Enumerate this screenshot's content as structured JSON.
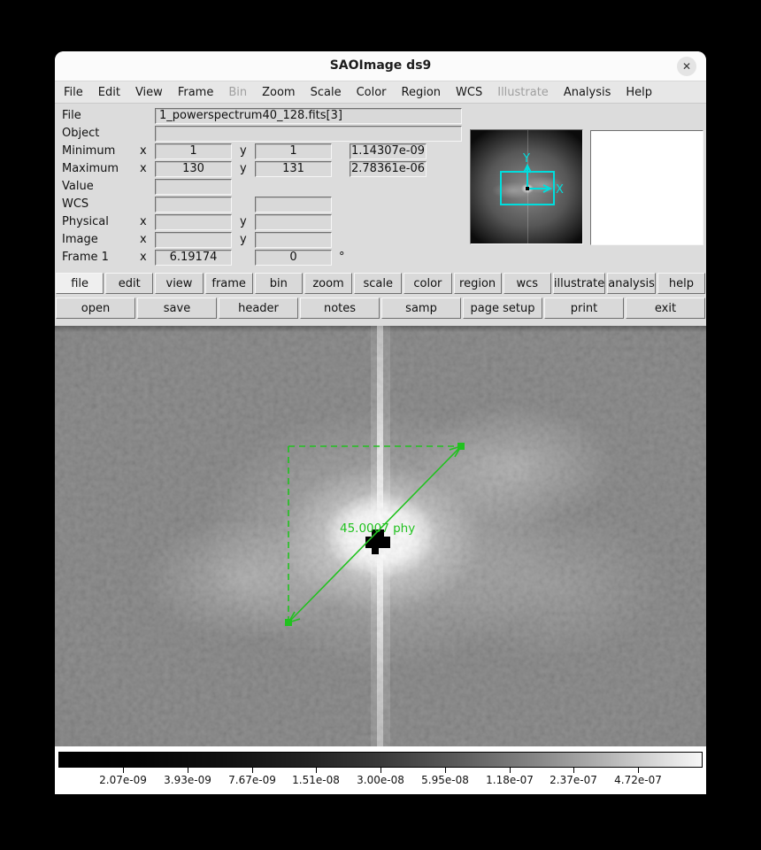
{
  "window": {
    "title": "SAOImage ds9",
    "close_glyph": "✕"
  },
  "menu": {
    "items": [
      "File",
      "Edit",
      "View",
      "Frame",
      "Bin",
      "Zoom",
      "Scale",
      "Color",
      "Region",
      "WCS",
      "Illustrate",
      "Analysis",
      "Help"
    ],
    "disabled_items": [
      "Bin",
      "Illustrate"
    ]
  },
  "info": {
    "xy": {
      "x": "x",
      "y": "y"
    },
    "file": {
      "label": "File",
      "value": "1_powerspectrum40_128.fits[3]"
    },
    "object": {
      "label": "Object",
      "value": ""
    },
    "minimum": {
      "label": "Minimum",
      "x": "1",
      "y": "1",
      "value": "1.14307e-09"
    },
    "maximum": {
      "label": "Maximum",
      "x": "130",
      "y": "131",
      "value": "2.78361e-06"
    },
    "value": {
      "label": "Value",
      "value": ""
    },
    "wcs": {
      "label": "WCS",
      "v1": "",
      "v2": ""
    },
    "physical": {
      "label": "Physical",
      "x": "",
      "y": ""
    },
    "image": {
      "label": "Image",
      "x": "",
      "y": ""
    },
    "frame": {
      "label": "Frame 1",
      "x": "6.19174",
      "angle": "0",
      "unit": "°"
    }
  },
  "panner": {
    "x_label": "X",
    "y_label": "Y",
    "accent_color": "#00dede"
  },
  "toolbar_primary": [
    "file",
    "edit",
    "view",
    "frame",
    "bin",
    "zoom",
    "scale",
    "color",
    "region",
    "wcs",
    "illustrate",
    "analysis",
    "help"
  ],
  "toolbar_primary_active": "file",
  "toolbar_secondary": [
    "open",
    "save",
    "header",
    "notes",
    "samp",
    "page setup",
    "print",
    "exit"
  ],
  "image_view": {
    "ruler_label": "45.0007 phy",
    "region_color": "#21c21f"
  },
  "colorbar": {
    "labels": [
      "2.07e-09",
      "3.93e-09",
      "7.67e-09",
      "1.51e-08",
      "3.00e-08",
      "5.95e-08",
      "1.18e-07",
      "2.37e-07",
      "4.72e-07"
    ]
  }
}
